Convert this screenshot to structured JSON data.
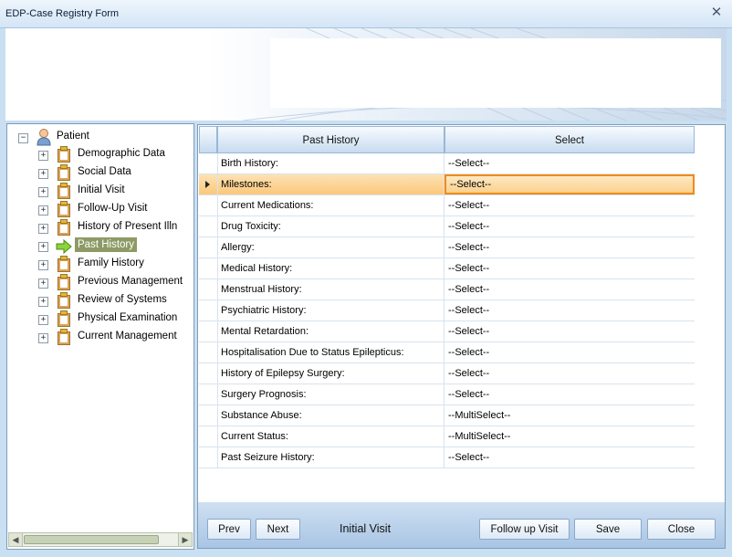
{
  "window": {
    "title": "EDP-Case Registry Form",
    "close_glyph": "✕"
  },
  "tree": {
    "root": {
      "label": "Patient",
      "icon": "user-icon",
      "expander": "−"
    },
    "items": [
      {
        "label": "Demographic Data",
        "icon": "clipboard-icon",
        "expander": "+"
      },
      {
        "label": "Social Data",
        "icon": "clipboard-icon",
        "expander": "+"
      },
      {
        "label": "Initial Visit",
        "icon": "clipboard-icon",
        "expander": "+"
      },
      {
        "label": "Follow-Up Visit",
        "icon": "clipboard-icon",
        "expander": "+"
      },
      {
        "label": "History of Present Illn",
        "icon": "clipboard-icon",
        "expander": "+"
      },
      {
        "label": "Past History",
        "icon": "arrow-right-icon",
        "expander": "+",
        "selected": true
      },
      {
        "label": "Family History",
        "icon": "clipboard-icon",
        "expander": "+"
      },
      {
        "label": "Previous Management",
        "icon": "clipboard-icon",
        "expander": "+"
      },
      {
        "label": "Review of Systems",
        "icon": "clipboard-icon",
        "expander": "+"
      },
      {
        "label": "Physical Examination",
        "icon": "clipboard-icon",
        "expander": "+"
      },
      {
        "label": "Current Management",
        "icon": "clipboard-icon",
        "expander": "+"
      }
    ],
    "scroll_glyphs": {
      "left": "◀",
      "right": "▶"
    }
  },
  "grid": {
    "columns": [
      "Past History",
      "Select"
    ],
    "active_row_index": 1,
    "rows": [
      {
        "label": "Birth History:",
        "value": "--Select--"
      },
      {
        "label": "Milestones:",
        "value": "--Select--"
      },
      {
        "label": "Current Medications:",
        "value": "--Select--"
      },
      {
        "label": "Drug Toxicity:",
        "value": "--Select--"
      },
      {
        "label": "Allergy:",
        "value": "--Select--"
      },
      {
        "label": "Medical History:",
        "value": "--Select--"
      },
      {
        "label": "Menstrual History:",
        "value": "--Select--"
      },
      {
        "label": "Psychiatric History:",
        "value": "--Select--"
      },
      {
        "label": "Mental Retardation:",
        "value": "--Select--"
      },
      {
        "label": "Hospitalisation Due to Status Epilepticus:",
        "value": "--Select--"
      },
      {
        "label": "History of Epilepsy Surgery:",
        "value": "--Select--"
      },
      {
        "label": "Surgery Prognosis:",
        "value": "--Select--"
      },
      {
        "label": "Substance Abuse:",
        "value": "--MultiSelect--"
      },
      {
        "label": "Current Status:",
        "value": "--MultiSelect--"
      },
      {
        "label": "Past Seizure History:",
        "value": "--Select--"
      }
    ]
  },
  "footer": {
    "prev": "Prev",
    "next": "Next",
    "status": "Initial Visit",
    "follow_up": "Follow up Visit",
    "save": "Save",
    "close": "Close"
  },
  "colors": {
    "selected_tree_bg": "#8d9a66",
    "active_row_border": "#f08a1a",
    "header_bg": "#c7dbf0"
  }
}
